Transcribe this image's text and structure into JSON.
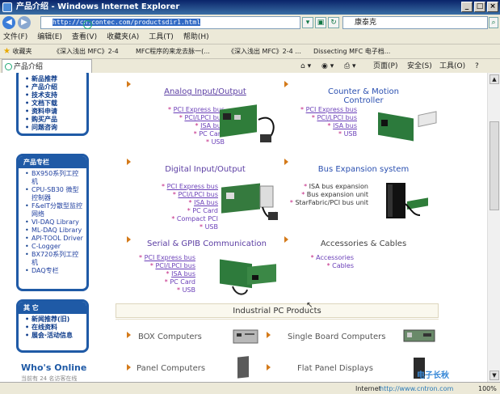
{
  "window": {
    "title": "产品介绍 - Windows Internet Explorer",
    "min": "_",
    "max": "□",
    "close": "×"
  },
  "address": {
    "url": "http://cn.contec.com/productsdir1.html",
    "search_value": "康泰克"
  },
  "menu": [
    "文件(F)",
    "编辑(E)",
    "查看(V)",
    "收藏夹(A)",
    "工具(T)",
    "帮助(H)"
  ],
  "favorites": {
    "label": "收藏夹",
    "items": [
      "《深入浅出 MFC》2-4",
      "MFC程序的来龙去脉一(...",
      "《深入浅出 MFC》2-4 ...",
      "Dissecting MFC 电子档..."
    ]
  },
  "tab": {
    "label": "产品介绍"
  },
  "commands": {
    "page": "页面(P)",
    "safety": "安全(S)",
    "tools": "工具(O)",
    "help": "?"
  },
  "sidebar": {
    "box1_items": [
      "新品推荐",
      "产品介绍",
      "技术支持",
      "文档下载",
      "资料申请",
      "购买产品",
      "问题咨询"
    ],
    "box2": {
      "title": "产品专栏",
      "items": [
        "BX950系列工控机",
        "CPU-SB30 微型控制器",
        "F&eIT分散型监控网络",
        "VI-DAQ Library",
        "ML-DAQ Library",
        "API-TOOL Driver",
        "C-Logger",
        "BX720系列工控机",
        "DAQ专栏"
      ]
    },
    "box3": {
      "title": "其 它",
      "items": [
        "新闻推荐(旧)",
        "在线资料",
        "展会·活动信息"
      ]
    },
    "whos_online": "Who's Online",
    "whos_sub": "当前有 24 名访客在线"
  },
  "products": [
    {
      "title": "Analog Input/Output",
      "items": [
        "PCI Express bus",
        "PCI/LPCI bus",
        "ISA bus",
        "PC Card",
        "USB"
      ]
    },
    {
      "title": "Counter & Motion Controller",
      "items": [
        "PCI Express bus",
        "PCI/LPCI bus",
        "ISA bus",
        "USB"
      ]
    },
    {
      "title": "Digital Input/Output",
      "items": [
        "PCI Express bus",
        "PCI/LPCI bus",
        "ISA bus",
        "PC Card",
        "Compact PCI",
        "USB"
      ]
    },
    {
      "title": "Bus Expansion system",
      "items": [
        "ISA bus expansion",
        "Bus expansion unit",
        "StarFabric/PCI bus unit"
      ]
    },
    {
      "title": "Serial & GPIB Communication",
      "items": [
        "PCI Express bus",
        "PCI/LPCI bus",
        "ISA bus",
        "PC Card",
        "USB"
      ]
    },
    {
      "title": "Accessories & Cables",
      "items": [
        "Accessories",
        "Cables"
      ]
    }
  ],
  "ipc": {
    "title": "Industrial PC Products",
    "cats": [
      "BOX Computers",
      "Single Board Computers",
      "Panel Computers",
      "Flat Panel Displays"
    ]
  },
  "status": {
    "zone": "Internet",
    "zoom": "100%",
    "watermark": "电子长秋",
    "watermark_url": "http://www.cntron.com"
  }
}
